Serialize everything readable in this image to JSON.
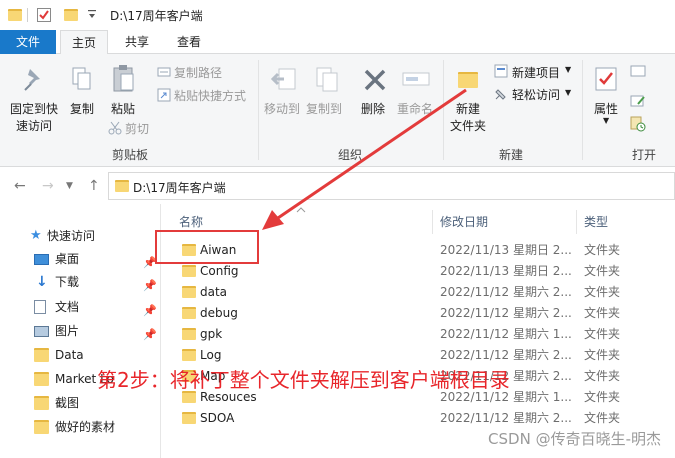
{
  "window": {
    "title_path": "D:\\17周年客户端"
  },
  "ribbon_tabs": [
    "文件",
    "主页",
    "共享",
    "查看"
  ],
  "ribbon": {
    "clipboard": {
      "pin_quick_access": "固定到快\n速访问",
      "copy": "复制",
      "paste": "粘贴",
      "copy_path": "复制路径",
      "paste_shortcut": "粘贴快捷方式",
      "cut": "剪切",
      "group_label": "剪贴板"
    },
    "organize": {
      "move_to": "移动到",
      "copy_to": "复制到",
      "delete": "删除",
      "rename": "重命名",
      "group_label": "组织"
    },
    "new": {
      "new_folder_l1": "新建",
      "new_folder_l2": "文件夹",
      "new_item": "新建项目",
      "easy_access": "轻松访问",
      "group_label": "新建"
    },
    "open": {
      "properties": "属性",
      "group_label": "打开"
    }
  },
  "address_bar": {
    "path": "D:\\17周年客户端"
  },
  "columns": {
    "name": "名称",
    "date_modified": "修改日期",
    "type": "类型"
  },
  "sidebar": {
    "quick_access": "快速访问",
    "items": [
      {
        "label": "桌面",
        "pinned": true
      },
      {
        "label": "下载",
        "pinned": true
      },
      {
        "label": "文档",
        "pinned": true
      },
      {
        "label": "图片",
        "pinned": true
      },
      {
        "label": "Data",
        "pinned": false
      },
      {
        "label": "Market Lo",
        "pinned": false
      },
      {
        "label": "截图",
        "pinned": false
      },
      {
        "label": "做好的素材",
        "pinned": false
      }
    ]
  },
  "files": [
    {
      "name": "Aiwan",
      "date": "2022/11/13 星期日 2...",
      "type": "文件夹"
    },
    {
      "name": "Config",
      "date": "2022/11/13 星期日 2...",
      "type": "文件夹"
    },
    {
      "name": "data",
      "date": "2022/11/12 星期六 2...",
      "type": "文件夹"
    },
    {
      "name": "debug",
      "date": "2022/11/12 星期六 2...",
      "type": "文件夹"
    },
    {
      "name": "gpk",
      "date": "2022/11/12 星期六 1...",
      "type": "文件夹"
    },
    {
      "name": "Log",
      "date": "2022/11/12 星期六 2...",
      "type": "文件夹"
    },
    {
      "name": "Map",
      "date": "2022/11/12 星期六 2...",
      "type": "文件夹"
    },
    {
      "name": "Resouces",
      "date": "2022/11/12 星期六 1...",
      "type": "文件夹"
    },
    {
      "name": "SDOA",
      "date": "2022/11/12 星期六 2...",
      "type": "文件夹"
    }
  ],
  "annotation": "第2步：将补丁整个文件夹解压到客户端根目录",
  "watermark": "CSDN @传奇百晓生-明杰",
  "colors": {
    "accent": "#1979ca",
    "annotation": "#e8262b",
    "folder": "#f8d775"
  }
}
